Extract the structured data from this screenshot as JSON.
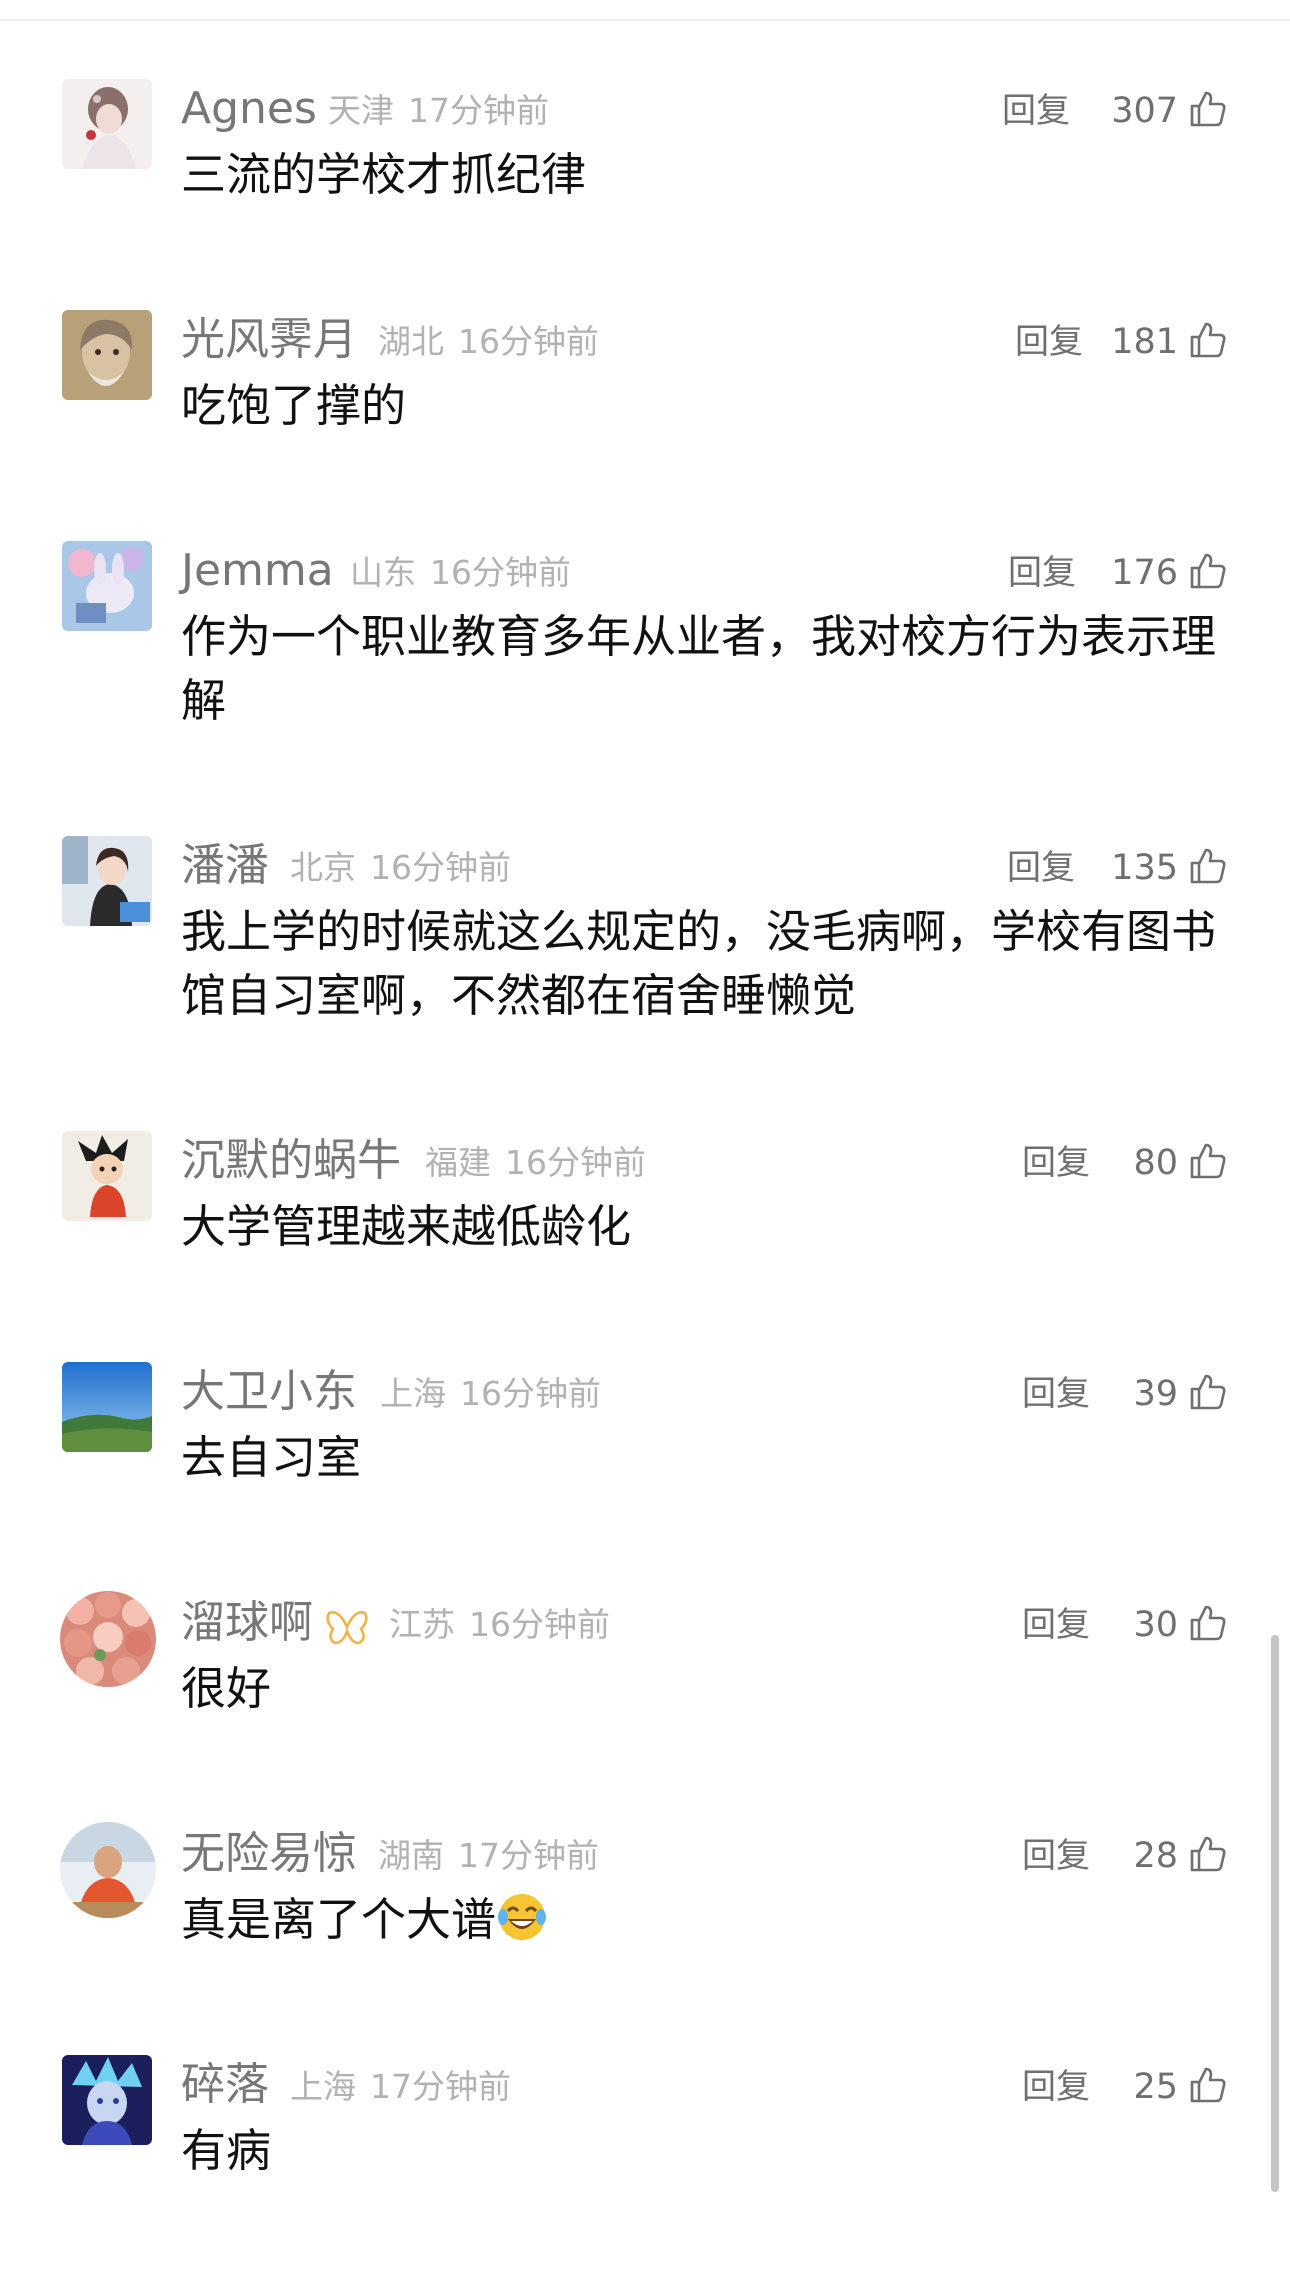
{
  "comments": [
    {
      "user": "Agnes",
      "location": "天津",
      "time": "17分钟前",
      "reply": "回复",
      "likes": "307",
      "text": "三流的学校才抓纪律"
    },
    {
      "user": "光风霁月",
      "location": "湖北",
      "time": "16分钟前",
      "reply": "回复",
      "likes": "181",
      "text": "吃饱了撑的"
    },
    {
      "user": "Jemma",
      "location": "山东",
      "time": "16分钟前",
      "reply": "回复",
      "likes": "176",
      "text": "作为一个职业教育多年从业者，我对校方行为表示理解"
    },
    {
      "user": "潘潘",
      "location": "北京",
      "time": "16分钟前",
      "reply": "回复",
      "likes": "135",
      "text": "我上学的时候就这么规定的，没毛病啊，学校有图书馆自习室啊，不然都在宿舍睡懒觉"
    },
    {
      "user": "沉默的蜗牛",
      "location": "福建",
      "time": "16分钟前",
      "reply": "回复",
      "likes": "80",
      "text": "大学管理越来越低龄化"
    },
    {
      "user": "大卫小东",
      "location": "上海",
      "time": "16分钟前",
      "reply": "回复",
      "likes": "39",
      "text": "去自习室"
    },
    {
      "user": "溜球啊",
      "location": "江苏",
      "time": "16分钟前",
      "reply": "回复",
      "likes": "30",
      "text": "很好"
    },
    {
      "user": "无险易惊",
      "location": "湖南",
      "time": "17分钟前",
      "reply": "回复",
      "likes": "28",
      "text": "真是离了个大谱"
    },
    {
      "user": "碎落",
      "location": "上海",
      "time": "17分钟前",
      "reply": "回复",
      "likes": "25",
      "text": "有病"
    }
  ],
  "icons": {
    "like": "thumbs-up-icon",
    "badge": "butterfly-badge-icon",
    "emoji": "laughing-crying-emoji-icon"
  },
  "colors": {
    "username": "#777777",
    "meta": "#b2b2b2",
    "text": "#111111",
    "badge": "#f2b24a"
  }
}
